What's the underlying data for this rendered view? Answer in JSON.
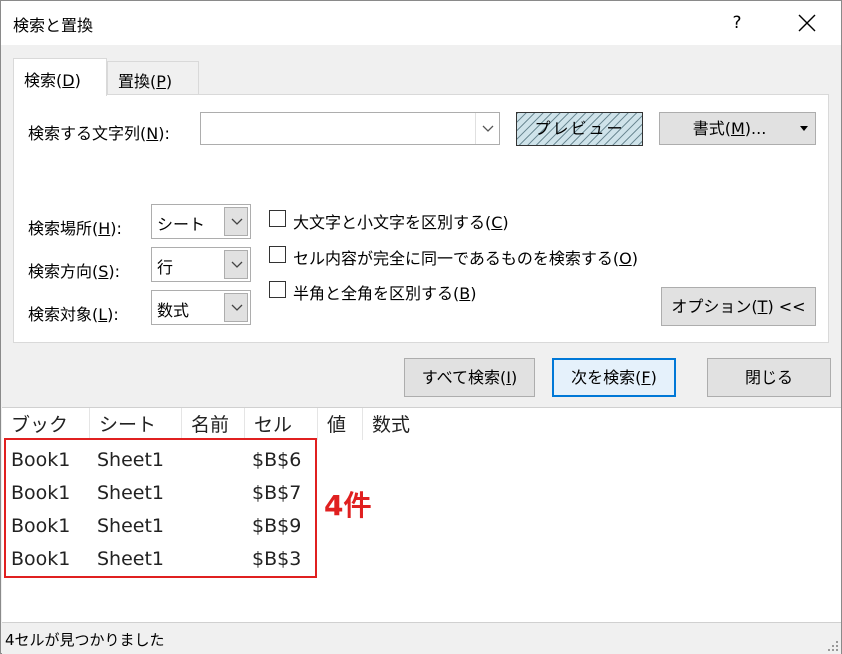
{
  "window": {
    "title": "検索と置換",
    "help_label": "?"
  },
  "tabs": [
    {
      "label_main": "検索(",
      "label_key": "D",
      "label_end": ")"
    },
    {
      "label_main": "置換(",
      "label_key": "P",
      "label_end": ")"
    }
  ],
  "find": {
    "label_main": "検索する文字列(",
    "label_key": "N",
    "label_end": "):",
    "value": "",
    "preview_label": "プレビュー",
    "format_main": "書式(",
    "format_key": "M",
    "format_end": ")..."
  },
  "options": {
    "within": {
      "label_main": "検索場所(",
      "label_key": "H",
      "label_end": "):",
      "value": "シート"
    },
    "search": {
      "label_main": "検索方向(",
      "label_key": "S",
      "label_end": "):",
      "value": "行"
    },
    "look_in": {
      "label_main": "検索対象(",
      "label_key": "L",
      "label_end": "):",
      "value": "数式"
    },
    "match_case": {
      "label_main": "大文字と小文字を区別する(",
      "label_key": "C",
      "label_end": ")",
      "checked": false
    },
    "match_entire": {
      "label_main": "セル内容が完全に同一であるものを検索する(",
      "label_key": "O",
      "label_end": ")",
      "checked": false
    },
    "match_byte": {
      "label_main": "半角と全角を区別する(",
      "label_key": "B",
      "label_end": ")",
      "checked": false
    },
    "options_button": {
      "label_main": "オプション(",
      "label_key": "T",
      "label_end": ") <<"
    }
  },
  "buttons": {
    "find_all": {
      "label_main": "すべて検索(",
      "label_key": "I",
      "label_end": ")"
    },
    "find_next": {
      "label_main": "次を検索(",
      "label_key": "F",
      "label_end": ")"
    },
    "close": "閉じる"
  },
  "results": {
    "columns": [
      "ブック",
      "シート",
      "名前",
      "セル",
      "値",
      "数式"
    ],
    "rows": [
      [
        "Book1",
        "Sheet1",
        "",
        "$B$6",
        "",
        ""
      ],
      [
        "Book1",
        "Sheet1",
        "",
        "$B$7",
        "",
        ""
      ],
      [
        "Book1",
        "Sheet1",
        "",
        "$B$9",
        "",
        ""
      ],
      [
        "Book1",
        "Sheet1",
        "",
        "$B$3",
        "",
        ""
      ]
    ],
    "annotation": "4件",
    "annotation_color": "#e02020"
  },
  "status": "4セルが見つかりました",
  "colors": {
    "accent": "#0078d7"
  }
}
